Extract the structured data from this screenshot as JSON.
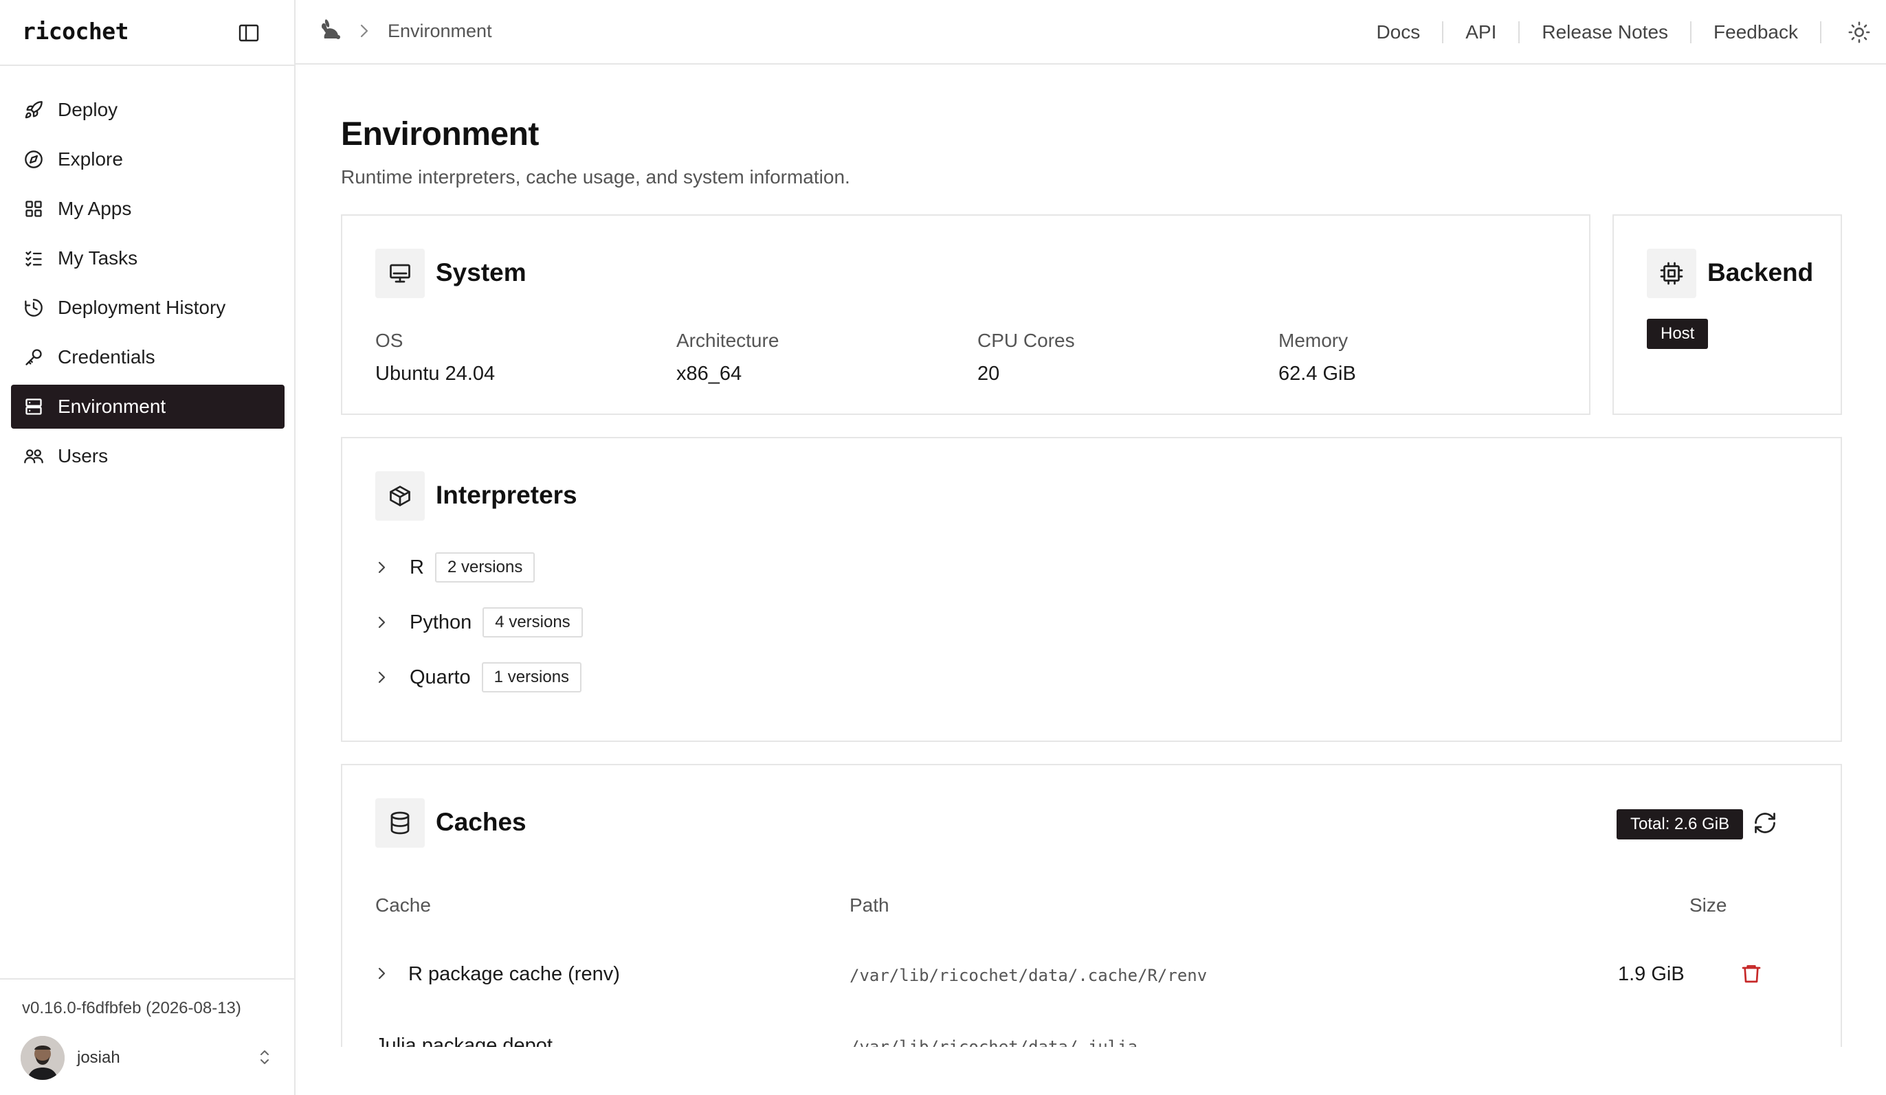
{
  "app": {
    "logo": "ricochet"
  },
  "sidebar": {
    "items": [
      {
        "label": "Deploy",
        "icon": "rocket-icon",
        "active": false
      },
      {
        "label": "Explore",
        "icon": "compass-icon",
        "active": false
      },
      {
        "label": "My Apps",
        "icon": "grid-icon",
        "active": false
      },
      {
        "label": "My Tasks",
        "icon": "list-checks-icon",
        "active": false
      },
      {
        "label": "Deployment History",
        "icon": "history-icon",
        "active": false
      },
      {
        "label": "Credentials",
        "icon": "key-icon",
        "active": false
      },
      {
        "label": "Environment",
        "icon": "server-icon",
        "active": true
      },
      {
        "label": "Users",
        "icon": "users-icon",
        "active": false
      }
    ],
    "version": "v0.16.0-f6dfbfeb (2026-08-13)",
    "user": {
      "name": "josiah"
    }
  },
  "breadcrumb": {
    "current": "Environment"
  },
  "topnav": {
    "links": [
      "Docs",
      "API",
      "Release Notes",
      "Feedback"
    ]
  },
  "page": {
    "title": "Environment",
    "subtitle": "Runtime interpreters, cache usage, and system information."
  },
  "system": {
    "title": "System",
    "fields": [
      {
        "label": "OS",
        "value": "Ubuntu 24.04"
      },
      {
        "label": "Architecture",
        "value": "x86_64"
      },
      {
        "label": "CPU Cores",
        "value": "20"
      },
      {
        "label": "Memory",
        "value": "62.4 GiB"
      }
    ]
  },
  "backend": {
    "title": "Backend",
    "badge": "Host"
  },
  "interpreters": {
    "title": "Interpreters",
    "items": [
      {
        "name": "R",
        "versions": "2 versions"
      },
      {
        "name": "Python",
        "versions": "4 versions"
      },
      {
        "name": "Quarto",
        "versions": "1 versions"
      }
    ]
  },
  "caches": {
    "title": "Caches",
    "total": "Total: 2.6 GiB",
    "columns": {
      "cache": "Cache",
      "path": "Path",
      "size": "Size"
    },
    "rows": [
      {
        "name": "R package cache (renv)",
        "path": "/var/lib/ricochet/data/.cache/R/renv",
        "size": "1.9 GiB"
      },
      {
        "name": "Julia package depot",
        "path": "/var/lib/ricochet/data/.julia",
        "size": ""
      }
    ]
  },
  "colors": {
    "accent_dark": "#221a1e",
    "danger": "#c62828",
    "border": "#e6e6e6"
  }
}
